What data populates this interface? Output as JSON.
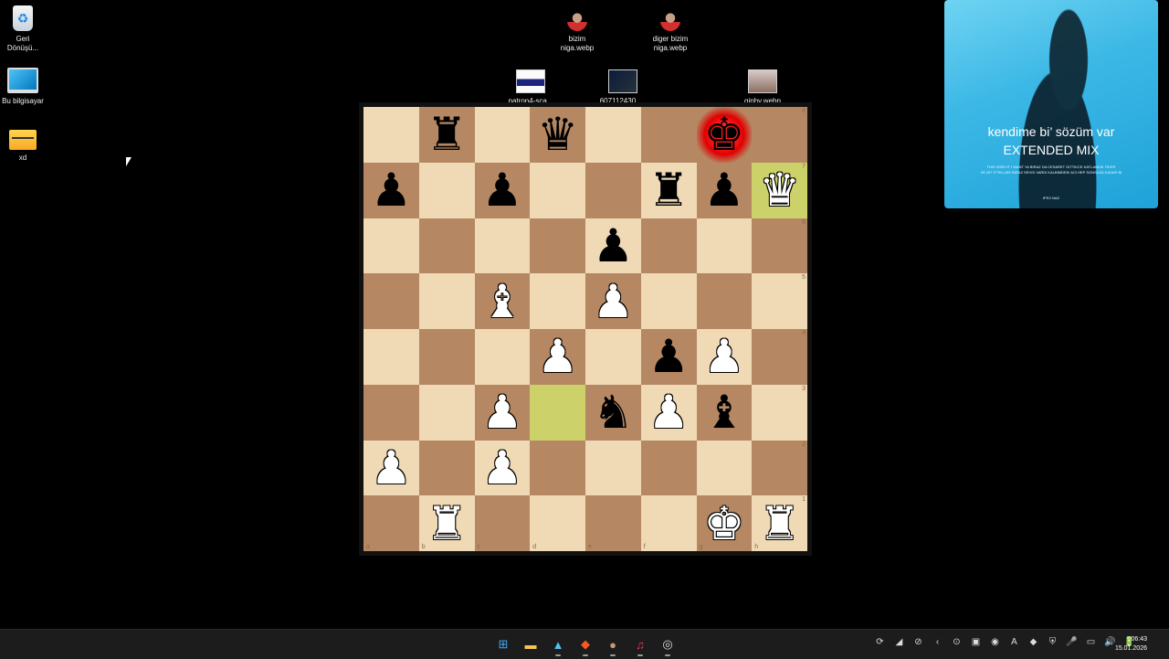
{
  "desktop": {
    "icons": [
      {
        "label": "Geri\nDönüşü...",
        "icon": "recycle-bin-icon"
      },
      {
        "label": "Bu bilgisayar",
        "icon": "computer-icon"
      },
      {
        "label": "xd",
        "icon": "folder-icon"
      },
      {
        "label": "bizim\nniga.webp",
        "icon": "image-file-icon"
      },
      {
        "label": "diger bizim\nniga.webp",
        "icon": "image-file-icon"
      },
      {
        "label": "patron4-sca...",
        "icon": "image-file-icon"
      },
      {
        "label": "607112430_...",
        "icon": "image-file-icon"
      },
      {
        "label": "giphy.webp",
        "icon": "image-file-icon"
      }
    ]
  },
  "chess": {
    "board": [
      [
        "",
        "r",
        "",
        "q",
        "",
        "",
        "k",
        ""
      ],
      [
        "p",
        "",
        "p",
        "",
        "",
        "r",
        "p",
        "Q"
      ],
      [
        "",
        "",
        "",
        "",
        "p",
        "",
        "",
        ""
      ],
      [
        "",
        "",
        "B",
        "",
        "P",
        "",
        "",
        ""
      ],
      [
        "",
        "",
        "",
        "P",
        "",
        "p",
        "P",
        ""
      ],
      [
        "",
        "",
        "P",
        "",
        "n",
        "P",
        "b",
        ""
      ],
      [
        "P",
        "",
        "P",
        "",
        "",
        "",
        "",
        ""
      ],
      [
        "",
        "R",
        "",
        "",
        "",
        "",
        "K",
        "R"
      ]
    ],
    "highlighted": [
      "h7",
      "d3"
    ],
    "check": "g8",
    "ranks": [
      "8",
      "7",
      "6",
      "5",
      "4",
      "3",
      "2",
      "1"
    ],
    "files": [
      "a",
      "b",
      "c",
      "d",
      "e",
      "f",
      "g",
      "h"
    ]
  },
  "media": {
    "title_line1": "kendime bi’ sözüm var",
    "title_line2": "EXTENDED MIX",
    "lyric_line1": "THIS WISH IF I WANT YA BIRAZ DA CESARET GITTIKCE KATLANDIK TIKER",
    "lyric_line2": "VE BIT ITTELLIKE BIRAZ SEVGI VARDI KALBIMDEKI ACI HEP SONSUZA KADAR BI",
    "credit": "IPSX NAZ"
  },
  "taskbar": {
    "apps": [
      {
        "name": "start-button",
        "glyph": "⊞",
        "color": "#3fa9f5"
      },
      {
        "name": "file-explorer-icon",
        "glyph": "▬",
        "color": "#f9c74f"
      },
      {
        "name": "photos-icon",
        "glyph": "▲",
        "color": "#4fc3f7"
      },
      {
        "name": "brave-browser-icon",
        "glyph": "◆",
        "color": "#ff5722"
      },
      {
        "name": "game-icon",
        "glyph": "●",
        "color": "#c49a6c"
      },
      {
        "name": "music-icon",
        "glyph": "♫",
        "color": "#ff2d55"
      },
      {
        "name": "obs-icon",
        "glyph": "◎",
        "color": "#dddddd"
      }
    ],
    "tray": [
      "⟳",
      "◢",
      "⊘",
      "‹",
      "⊙",
      "▣",
      "◉",
      "A",
      "◆",
      "⛨",
      "🎤",
      "▭",
      "🔊",
      "🔋"
    ],
    "time": "06:43",
    "date": "15.01.2026"
  }
}
